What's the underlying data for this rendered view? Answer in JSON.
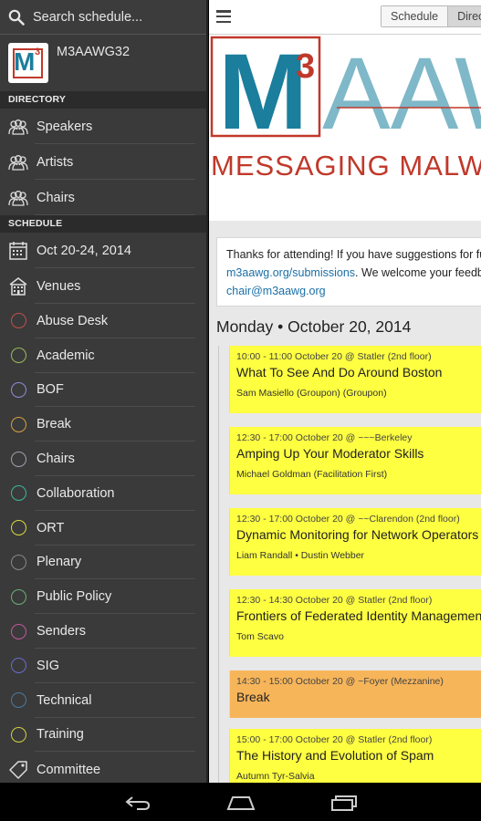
{
  "drawer": {
    "search_placeholder": "Search schedule...",
    "app_name": "M3AAWG32",
    "app_logo_letter": "M",
    "app_logo_super": "3",
    "directory_header": "DIRECTORY",
    "directory_items": [
      {
        "label": "Speakers",
        "icon": "people-icon"
      },
      {
        "label": "Artists",
        "icon": "people-icon"
      },
      {
        "label": "Chairs",
        "icon": "people-icon"
      }
    ],
    "schedule_header": "SCHEDULE",
    "dates_label": "Oct 20-24, 2014",
    "venues_label": "Venues",
    "categories": [
      {
        "label": "Abuse Desk",
        "color": "#c0504d"
      },
      {
        "label": "Academic",
        "color": "#9bbb59"
      },
      {
        "label": "BOF",
        "color": "#8c8cd8"
      },
      {
        "label": "Break",
        "color": "#d4a040"
      },
      {
        "label": "Chairs",
        "color": "#a0a0b0"
      },
      {
        "label": "Collaboration",
        "color": "#3cb89a"
      },
      {
        "label": "ORT",
        "color": "#d8d840"
      },
      {
        "label": "Plenary",
        "color": "#888888"
      },
      {
        "label": "Public Policy",
        "color": "#6ab07a"
      },
      {
        "label": "Senders",
        "color": "#c05a9a"
      },
      {
        "label": "SIG",
        "color": "#6a6ad0"
      },
      {
        "label": "Technical",
        "color": "#4a7aa0"
      },
      {
        "label": "Training",
        "color": "#d0d040"
      }
    ],
    "committee_label": "Committee"
  },
  "main": {
    "view_tabs": [
      "Schedule",
      "Directory"
    ],
    "active_tab": "Directory",
    "banner": {
      "logo_letter": "M",
      "logo_super": "3",
      "logo_tail": "AAWG",
      "tagline": "MESSAGING  MALWARE"
    },
    "notice": {
      "line1": "Thanks for attending! If you have suggestions for future",
      "link1": "m3aawg.org/submissions",
      "line2_rest": ". We welcome your feedback at",
      "link2": "chair@m3aawg.org"
    },
    "day_heading": "Monday • October 20, 2014",
    "sessions": [
      {
        "when": "10:00 - 11:00 October 20 @ Statler (2nd floor)",
        "title": "What To See And Do Around Boston",
        "who": "Sam Masiello (Groupon) (Groupon)",
        "color": "#ffff42"
      },
      {
        "when": "12:30 - 17:00 October 20 @ ~~~Berkeley",
        "title": "Amping Up Your Moderator Skills",
        "who": "Michael Goldman (Facilitation First)",
        "color": "#ffff42"
      },
      {
        "when": "12:30 - 17:00 October 20 @ ~~Clarendon (2nd floor)",
        "title": "Dynamic Monitoring for Network Operators",
        "who": "Liam Randall • Dustin Webber",
        "color": "#ffff42"
      },
      {
        "when": "12:30 - 14:30 October 20 @ Statler (2nd floor)",
        "title": "Frontiers of Federated Identity Management",
        "who": "Tom Scavo",
        "color": "#ffff42"
      },
      {
        "when": "14:30 - 15:00 October 20 @ ~Foyer (Mezzanine)",
        "title": "Break",
        "who": "",
        "color": "#f7b55a"
      },
      {
        "when": "15:00 - 17:00 October 20 @ Statler (2nd floor)",
        "title": "The History and Evolution of Spam",
        "who": "Autumn Tyr-Salvia",
        "color": "#ffff42"
      }
    ]
  }
}
